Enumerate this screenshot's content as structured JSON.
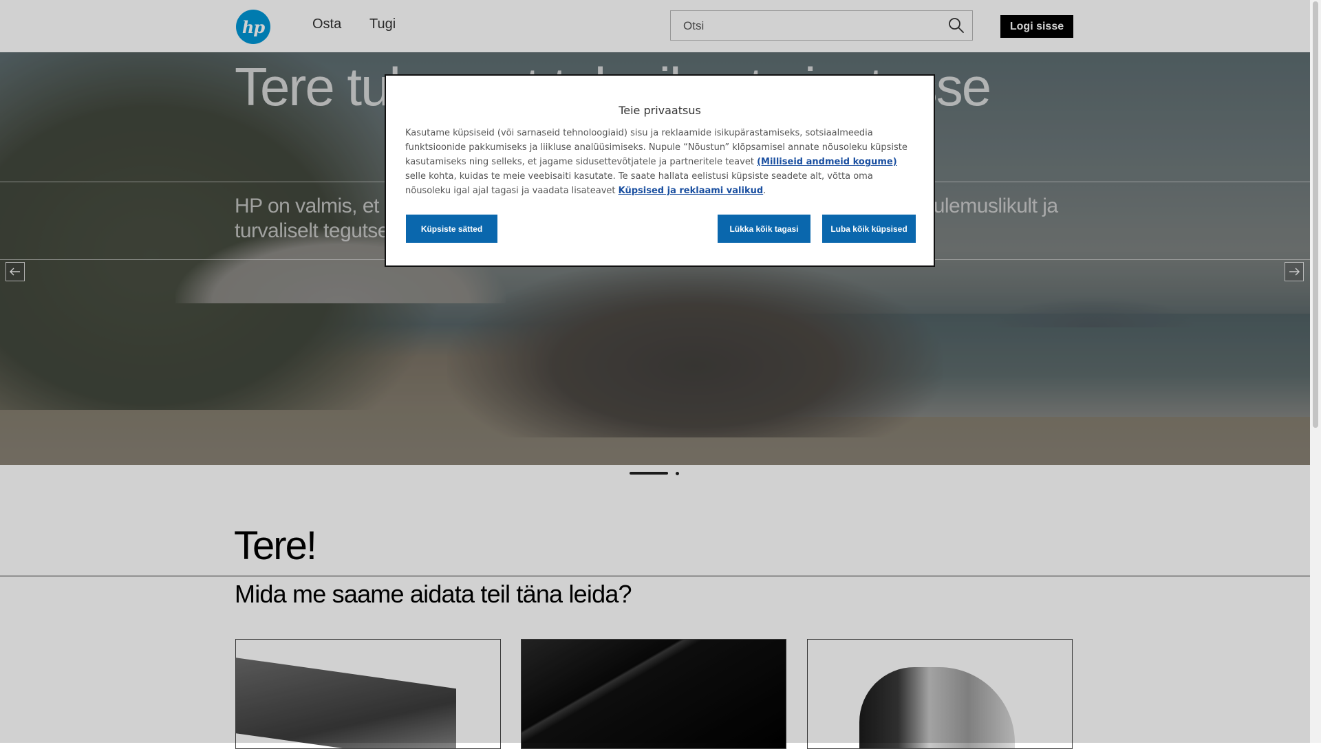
{
  "header": {
    "logo_text": "hp",
    "nav": {
      "shop": "Osta",
      "support": "Tugi"
    },
    "search": {
      "placeholder": "Otsi"
    },
    "login_label": "Logi sisse"
  },
  "hero": {
    "title": "Tere tulemast tulevikust ajastusse",
    "subtitle": "HP on valmis, et vormida teie ettevõtte kasvu ja aidata teil arendust hoida ning tulemuslikult ja turvaliselt tegutseda"
  },
  "carousel": {
    "slide_count": 2,
    "active_index": 0
  },
  "welcome": {
    "title": "Tere!",
    "subtitle": "Mida me saame aidata teil täna leida?"
  },
  "consent": {
    "title": "Teie privaatsus",
    "text_1": "Kasutame küpsiseid (või sarnaseid tehnoloogiaid) sisu ja reklaamide isikupärastamiseks, sotsiaalmeedia funktsioonide pakkumiseks ja liikluse analüüsimiseks. Nupule “Nõustun” klõpsamisel annate nõusoleku küpsiste kasutamiseks ning selleks, et jagame sidusettevõtjatele ja partneritele teavet ",
    "link_1": "(Milliseid andmeid kogume)",
    "text_2": " selle kohta, kuidas te meie veebisaiti kasutate. Te saate hallata eelistusi küpsiste seadete alt, võtta oma nõusoleku igal ajal tagasi ja vaadata lisateavet ",
    "link_2": "Küpsised ja reklaami valikud",
    "text_3": ".",
    "settings_label": "Küpsiste sätted",
    "reject_label": "Lükka kõik tagasi",
    "accept_label": "Luba kõik küpsised"
  },
  "colors": {
    "accent": "#0a67ad",
    "link": "#1a4fa0",
    "logo": "#0096d6",
    "login_bg": "#000000"
  },
  "icons": [
    "hp-logo",
    "search-icon",
    "arrow-left-icon",
    "arrow-right-icon"
  ]
}
